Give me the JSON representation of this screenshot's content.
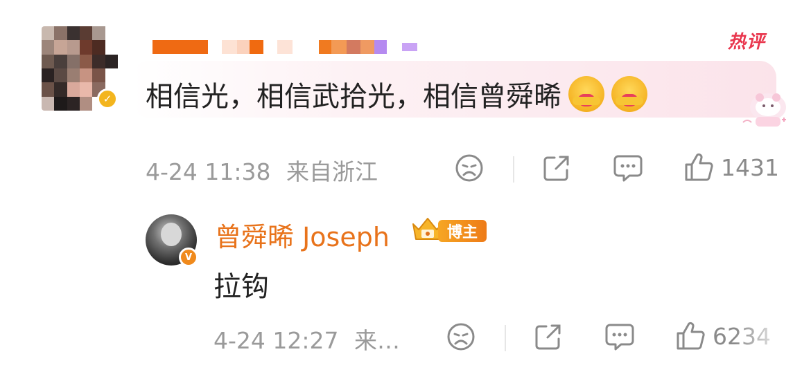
{
  "top_comment": {
    "badge": "热评",
    "text": "相信光，相信武拾光，相信曾舜晞",
    "emoji_icons": [
      "hug-emoji",
      "hug-emoji"
    ],
    "timestamp": "4-24 11:38",
    "location": "来自浙江",
    "like_count": "1431",
    "icons": [
      "dislike-face-icon",
      "share-icon",
      "comment-icon",
      "like-icon"
    ]
  },
  "reply": {
    "author": "曾舜晞 Joseph",
    "role_badge": "博主",
    "text": "拉钩",
    "timestamp": "4-24 12:27",
    "location": "来…",
    "like_count": "6234",
    "icons": [
      "dislike-face-icon",
      "share-icon",
      "comment-icon",
      "like-icon"
    ]
  },
  "colors": {
    "accent_orange": "#e8731b",
    "hot_red": "#e9374e",
    "meta_gray": "#9a9a9a"
  }
}
